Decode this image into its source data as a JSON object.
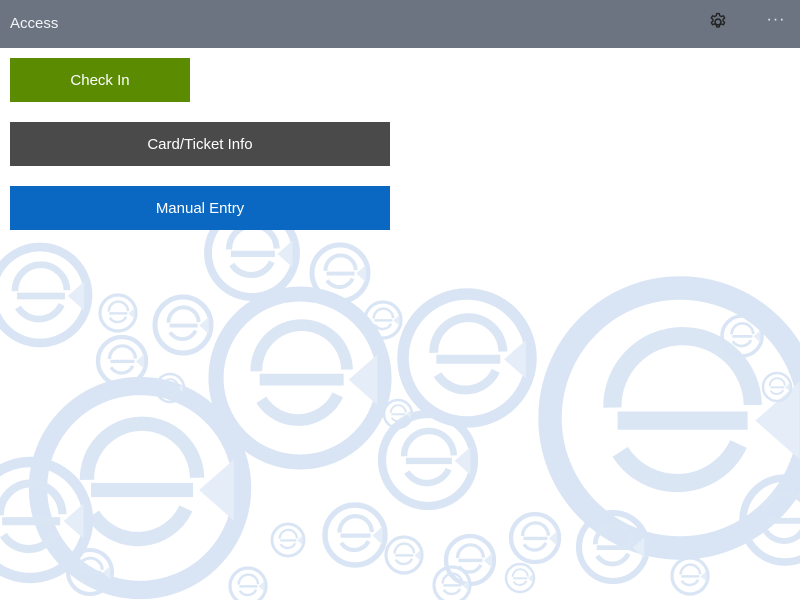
{
  "titlebar": {
    "title": "Access",
    "settings_icon": "gear-icon",
    "more_label": "···"
  },
  "actions": {
    "check_in_label": "Check In",
    "card_ticket_info_label": "Card/Ticket Info",
    "manual_entry_label": "Manual Entry"
  },
  "colors": {
    "titlebar": "#6b7480",
    "check_in": "#5a8b00",
    "card_ticket_info": "#4a4a4a",
    "manual_entry": "#0a67c2",
    "background_pattern": "#d7e3f3"
  }
}
